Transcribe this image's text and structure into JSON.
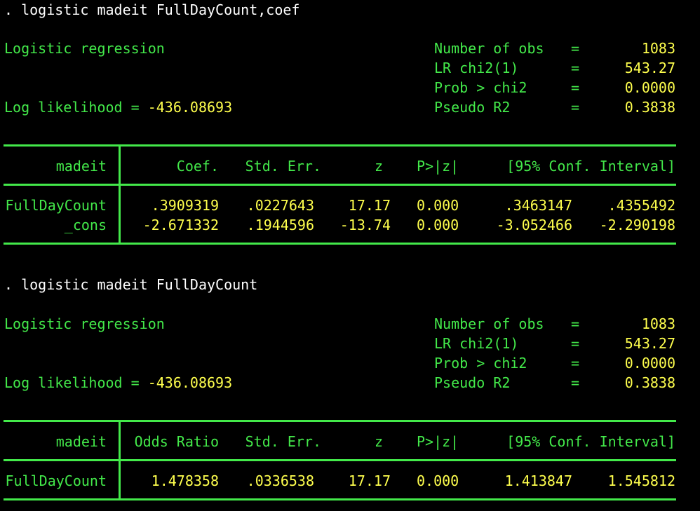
{
  "blocks": [
    {
      "command": ". logistic madeit FullDayCount,coef",
      "title": "Logistic regression",
      "loglik_label": "Log likelihood = ",
      "loglik_value": "-436.08693",
      "stats": [
        {
          "label": "Number of obs",
          "eq": "=",
          "value": "1083"
        },
        {
          "label": "LR chi2(1)",
          "eq": "=",
          "value": "543.27"
        },
        {
          "label": "Prob > chi2",
          "eq": "=",
          "value": "0.0000"
        },
        {
          "label": "Pseudo R2",
          "eq": "=",
          "value": "0.3838"
        }
      ],
      "header": {
        "depvar": "madeit",
        "col1": "Coef.",
        "col2": "Std. Err.",
        "col3": "z",
        "col4": "P>|z|",
        "col5": "[95% Conf. Interval]"
      },
      "rows": [
        {
          "name": "FullDayCount",
          "c1": ".3909319",
          "c2": ".0227643",
          "c3": "17.17",
          "c4": "0.000",
          "c5": ".3463147",
          "c6": ".4355492"
        },
        {
          "name": "_cons",
          "c1": "-2.671332",
          "c2": ".1944596",
          "c3": "-13.74",
          "c4": "0.000",
          "c5": "-3.052466",
          "c6": "-2.290198"
        }
      ]
    },
    {
      "command": ". logistic madeit FullDayCount",
      "title": "Logistic regression",
      "loglik_label": "Log likelihood = ",
      "loglik_value": "-436.08693",
      "stats": [
        {
          "label": "Number of obs",
          "eq": "=",
          "value": "1083"
        },
        {
          "label": "LR chi2(1)",
          "eq": "=",
          "value": "543.27"
        },
        {
          "label": "Prob > chi2",
          "eq": "=",
          "value": "0.0000"
        },
        {
          "label": "Pseudo R2",
          "eq": "=",
          "value": "0.3838"
        }
      ],
      "header": {
        "depvar": "madeit",
        "col1": "Odds Ratio",
        "col2": "Std. Err.",
        "col3": "z",
        "col4": "P>|z|",
        "col5": "[95% Conf. Interval]"
      },
      "rows": [
        {
          "name": "FullDayCount",
          "c1": "1.478358",
          "c2": ".0336538",
          "c3": "17.17",
          "c4": "0.000",
          "c5": "1.413847",
          "c6": "1.545812"
        }
      ]
    }
  ],
  "colors": {
    "background": "#000000",
    "text": "#ffffff",
    "green": "#43e94a",
    "yellow": "#ffff4d"
  }
}
